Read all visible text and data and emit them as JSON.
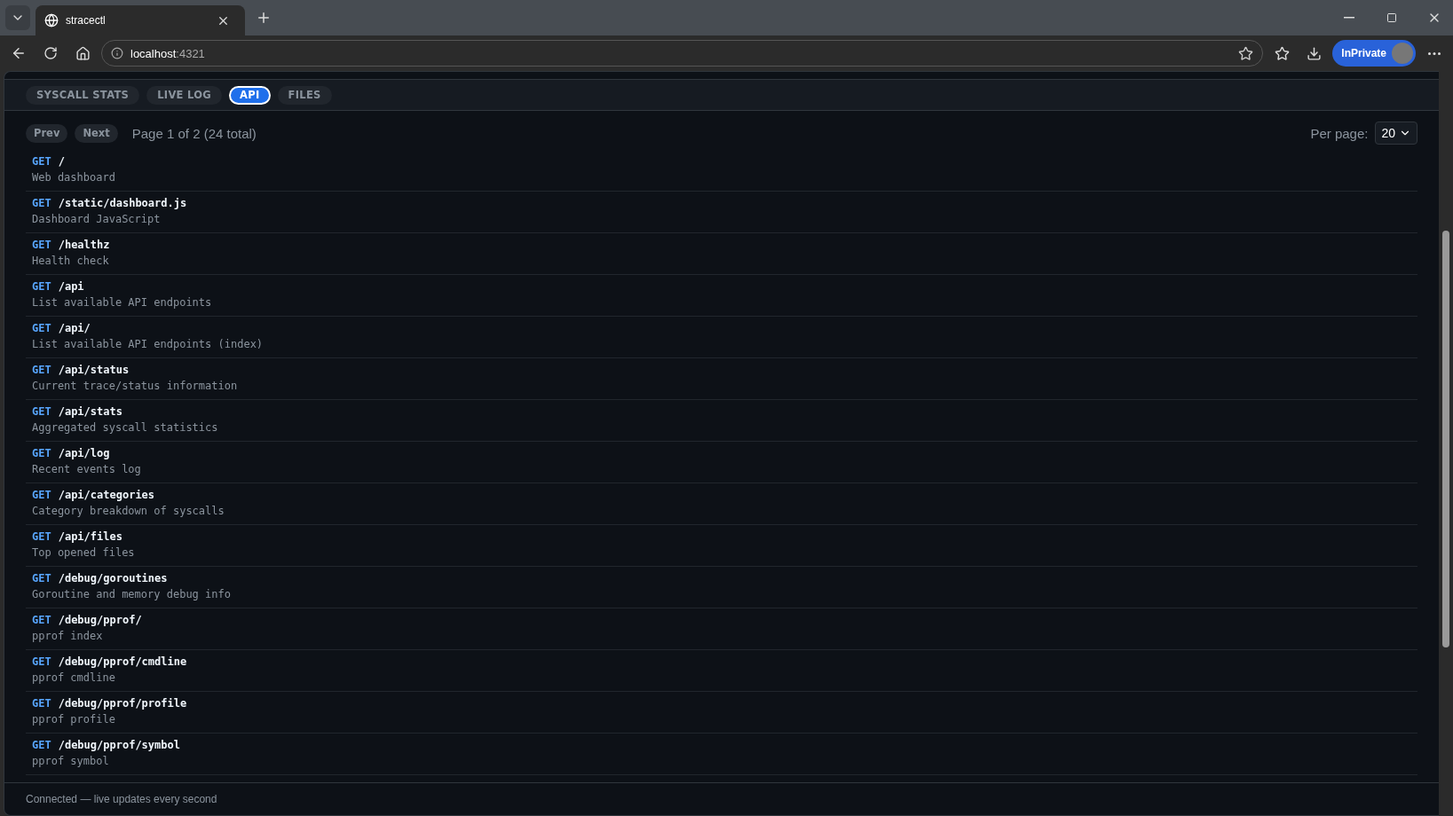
{
  "browser": {
    "tab_title": "stracectl",
    "address_host": "localhost",
    "address_port": ":4321",
    "profile_label": "InPrivate"
  },
  "tabs": [
    {
      "label": "SYSCALL STATS",
      "selected": false
    },
    {
      "label": "LIVE LOG",
      "selected": false
    },
    {
      "label": "API",
      "selected": true
    },
    {
      "label": "FILES",
      "selected": false
    }
  ],
  "pagination": {
    "prev": "Prev",
    "next": "Next",
    "summary": "Page 1 of 2 (24 total)",
    "per_page_label": "Per page:",
    "per_page_value": "20"
  },
  "endpoints": [
    {
      "method": "GET",
      "path": "/",
      "description": "Web dashboard"
    },
    {
      "method": "GET",
      "path": "/static/dashboard.js",
      "description": "Dashboard JavaScript"
    },
    {
      "method": "GET",
      "path": "/healthz",
      "description": "Health check"
    },
    {
      "method": "GET",
      "path": "/api",
      "description": "List available API endpoints"
    },
    {
      "method": "GET",
      "path": "/api/",
      "description": "List available API endpoints (index)"
    },
    {
      "method": "GET",
      "path": "/api/status",
      "description": "Current trace/status information"
    },
    {
      "method": "GET",
      "path": "/api/stats",
      "description": "Aggregated syscall statistics"
    },
    {
      "method": "GET",
      "path": "/api/log",
      "description": "Recent events log"
    },
    {
      "method": "GET",
      "path": "/api/categories",
      "description": "Category breakdown of syscalls"
    },
    {
      "method": "GET",
      "path": "/api/files",
      "description": "Top opened files"
    },
    {
      "method": "GET",
      "path": "/debug/goroutines",
      "description": "Goroutine and memory debug info"
    },
    {
      "method": "GET",
      "path": "/debug/pprof/",
      "description": "pprof index"
    },
    {
      "method": "GET",
      "path": "/debug/pprof/cmdline",
      "description": "pprof cmdline"
    },
    {
      "method": "GET",
      "path": "/debug/pprof/profile",
      "description": "pprof profile"
    },
    {
      "method": "GET",
      "path": "/debug/pprof/symbol",
      "description": "pprof symbol"
    }
  ],
  "status_bar": "Connected — live updates every second"
}
